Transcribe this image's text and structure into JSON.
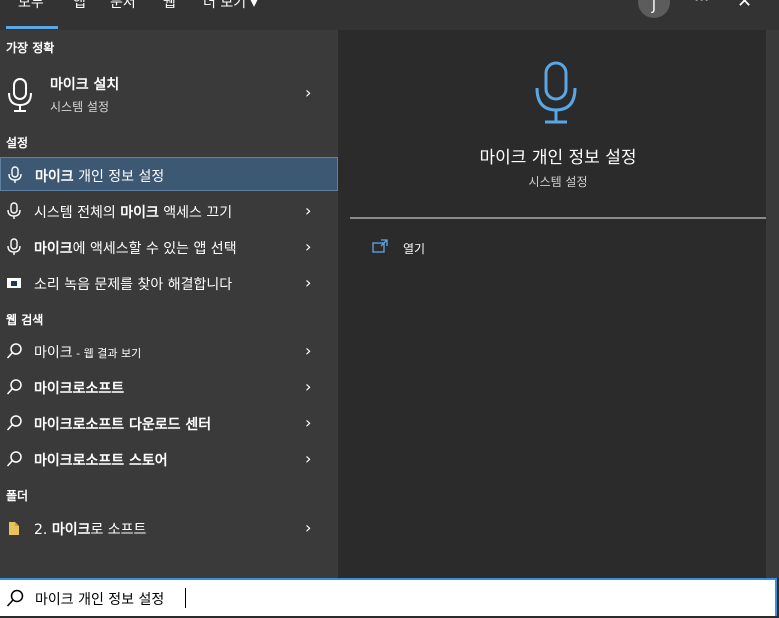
{
  "tabs": [
    {
      "label": "모두"
    },
    {
      "label": "앱"
    },
    {
      "label": "문서"
    },
    {
      "label": "웹"
    },
    {
      "label": "더 보기 ▾"
    }
  ],
  "account": {
    "initial": "J"
  },
  "more_label": "···",
  "close_label": "✕",
  "chevron": "›",
  "sections": {
    "best": "가장 정확",
    "settings": "설정",
    "web": "웹 검색",
    "folders": "폴더"
  },
  "best_match": {
    "title": "마이크 설치",
    "subtitle": "시스템 설정"
  },
  "settings_items": [
    {
      "bold": "마이크",
      "rest": " 개인 정보 설정",
      "icon": "microphone-icon"
    },
    {
      "pre": "시스템 전체의 ",
      "bold": "마이크",
      "rest": " 액세스 끄기",
      "icon": "microphone-icon"
    },
    {
      "bold": "마이크",
      "rest": "에 액세스할 수 있는 앱 선택",
      "icon": "microphone-icon"
    },
    {
      "text": "소리 녹음 문제를 찾아 해결합니다",
      "icon": "troubleshoot-icon"
    }
  ],
  "web_items": [
    {
      "text": "마이크",
      "suffix": " - 웹 결과 보기"
    },
    {
      "text": "마이크로소프트"
    },
    {
      "text": "마이크로소프트 다운로드 센터"
    },
    {
      "text": "마이크로소프트 스토어"
    }
  ],
  "folder_item": {
    "pre": "2. ",
    "bold": "마이크",
    "rest": "로 소프트"
  },
  "preview": {
    "title": "마이크 개인 정보 설정",
    "subtitle": "시스템 설정",
    "open_label": "열기"
  },
  "search": {
    "value": "마이크 개인 정보 설정"
  },
  "colors": {
    "accent": "#5aa7e6",
    "selected_bg": "#3d5873",
    "left_bg": "#3a3a3a",
    "right_bg": "#2b2b2b"
  }
}
